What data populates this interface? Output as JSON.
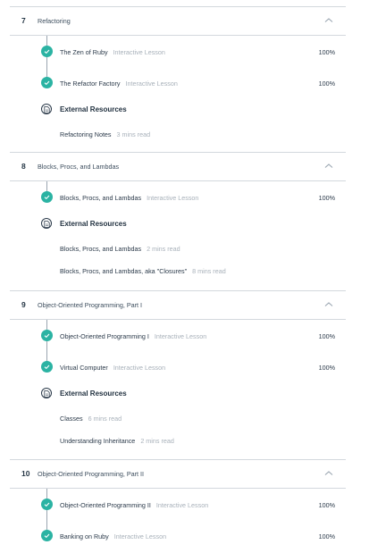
{
  "sections": [
    {
      "number": "7",
      "title": "Refactoring",
      "lessons": [
        {
          "name": "The Zen of Ruby",
          "type": "Interactive Lesson",
          "progress": "100%"
        },
        {
          "name": "The Refactor Factory",
          "type": "Interactive Lesson",
          "progress": "100%"
        }
      ],
      "resources_title": "External Resources",
      "resources": [
        {
          "name": "Refactoring Notes",
          "time": "3 mins read"
        }
      ]
    },
    {
      "number": "8",
      "title": "Blocks, Procs, and Lambdas",
      "lessons": [
        {
          "name": "Blocks, Procs, and Lambdas",
          "type": "Interactive Lesson",
          "progress": "100%"
        }
      ],
      "resources_title": "External Resources",
      "resources": [
        {
          "name": "Blocks, Procs, and Lambdas",
          "time": "2 mins read"
        },
        {
          "name": "Blocks, Procs, and Lambdas, aka \"Closures\"",
          "time": "8 mins read"
        }
      ]
    },
    {
      "number": "9",
      "title": "Object-Oriented Programming, Part I",
      "lessons": [
        {
          "name": "Object-Oriented Programming I",
          "type": "Interactive Lesson",
          "progress": "100%"
        },
        {
          "name": "Virtual Computer",
          "type": "Interactive Lesson",
          "progress": "100%"
        }
      ],
      "resources_title": "External Resources",
      "resources": [
        {
          "name": "Classes",
          "time": "6 mins read"
        },
        {
          "name": "Understanding Inheritance",
          "time": "2 mins read"
        }
      ]
    },
    {
      "number": "10",
      "title": "Object-Oriented Programming, Part II",
      "lessons": [
        {
          "name": "Object-Oriented Programming II",
          "type": "Interactive Lesson",
          "progress": "100%"
        },
        {
          "name": "Banking on Ruby",
          "type": "Interactive Lesson",
          "progress": "100%"
        }
      ],
      "resources_title": "",
      "resources": []
    }
  ],
  "icons": {
    "collapse": "chevron-up-icon",
    "completed": "check-circle-icon",
    "resource": "document-icon"
  },
  "colors": {
    "accent": "#2bb3a3",
    "muted_text": "#a8b1ba",
    "divider": "#d3d8dd"
  }
}
